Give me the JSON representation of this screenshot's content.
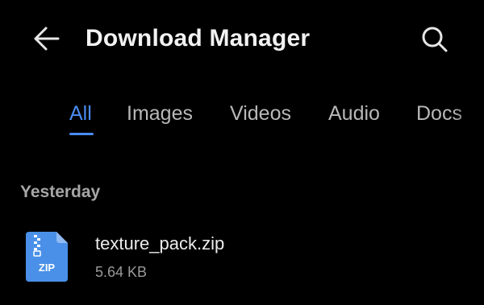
{
  "header": {
    "title": "Download Manager",
    "back_icon": "arrow-left-icon",
    "search_icon": "search-icon"
  },
  "tabs": [
    {
      "label": "All",
      "active": true
    },
    {
      "label": "Images",
      "active": false
    },
    {
      "label": "Videos",
      "active": false
    },
    {
      "label": "Audio",
      "active": false
    },
    {
      "label": "Docs",
      "active": false
    }
  ],
  "sections": [
    {
      "label": "Yesterday",
      "files": [
        {
          "name": "texture_pack.zip",
          "size": "5.64 KB",
          "icon": "zip-file-icon",
          "icon_label": "ZIP"
        }
      ]
    }
  ],
  "colors": {
    "background": "#000000",
    "accent": "#4a8cf2",
    "file_icon": "#4a90e8"
  }
}
